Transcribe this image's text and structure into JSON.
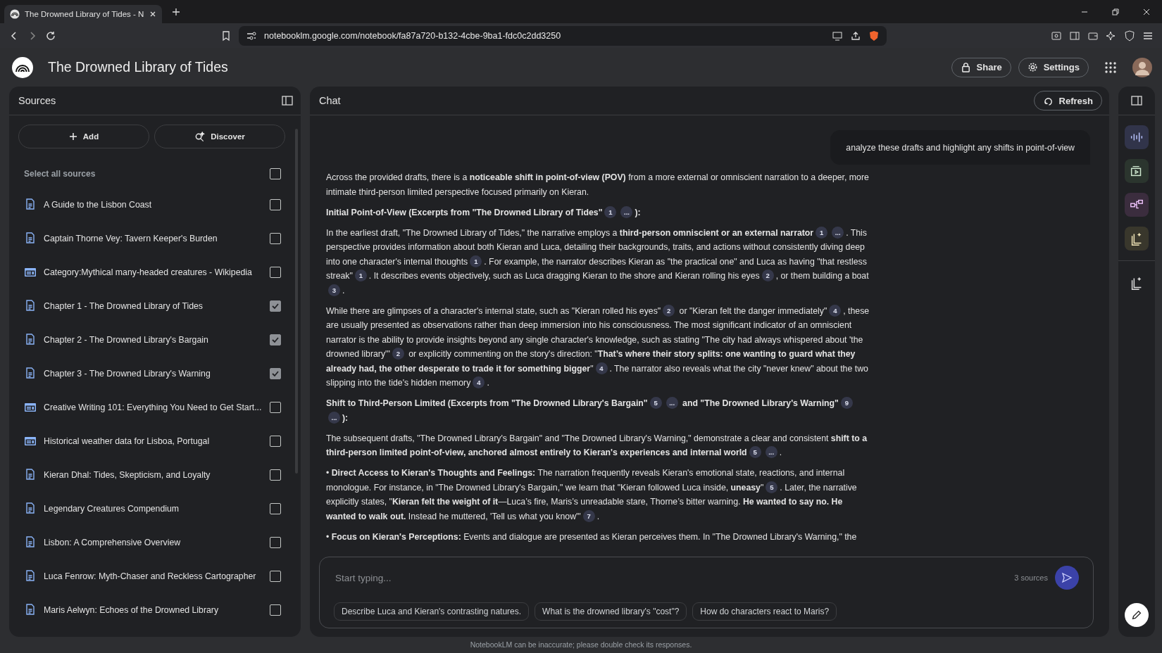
{
  "browser": {
    "tab_title": "The Drowned Library of Tides - N",
    "url": "notebooklm.google.com/notebook/fa87a720-b132-4cbe-9ba1-fdc0c2dd3250"
  },
  "header": {
    "title": "The Drowned Library of Tides",
    "share": "Share",
    "settings": "Settings"
  },
  "sources": {
    "title": "Sources",
    "add": "Add",
    "discover": "Discover",
    "select_all": {
      "label": "Select all sources",
      "checked": false
    },
    "items": [
      {
        "title": "A Guide to the Lisbon Coast",
        "kind": "doc",
        "checked": false
      },
      {
        "title": "Captain Thorne Vey: Tavern Keeper's Burden",
        "kind": "doc",
        "checked": false
      },
      {
        "title": "Category:Mythical many-headed creatures - Wikipedia",
        "kind": "web",
        "checked": false
      },
      {
        "title": "Chapter 1 - The Drowned Library of Tides",
        "kind": "doc",
        "checked": true
      },
      {
        "title": "Chapter 2 - The Drowned Library's Bargain",
        "kind": "doc",
        "checked": true
      },
      {
        "title": "Chapter 3 - The Drowned Library's Warning",
        "kind": "doc",
        "checked": true
      },
      {
        "title": "Creative Writing 101: Everything You Need to Get Start...",
        "kind": "web",
        "checked": false
      },
      {
        "title": "Historical weather data for Lisboa, Portugal",
        "kind": "web",
        "checked": false
      },
      {
        "title": "Kieran Dhal: Tides, Skepticism, and Loyalty",
        "kind": "doc",
        "checked": false
      },
      {
        "title": "Legendary Creatures Compendium",
        "kind": "doc",
        "checked": false
      },
      {
        "title": "Lisbon: A Comprehensive Overview",
        "kind": "doc",
        "checked": false
      },
      {
        "title": "Luca Fenrow: Myth-Chaser and Reckless Cartographer",
        "kind": "doc",
        "checked": false
      },
      {
        "title": "Maris Aelwyn: Echoes of the Drowned Library",
        "kind": "doc",
        "checked": false
      }
    ]
  },
  "chat": {
    "title": "Chat",
    "refresh": "Refresh",
    "user_message": "analyze these drafts and highlight any shifts in point-of-view",
    "paragraphs": [
      {
        "kind": "para",
        "parts": [
          {
            "kind": "text",
            "text": "Across the provided drafts, there is a **noticeable shift in point-of-view (POV)** from a more external or omniscient narration to a deeper, more intimate third-person limited perspective focused primarily on Kieran."
          }
        ]
      },
      {
        "kind": "heading",
        "parts": [
          {
            "kind": "text",
            "text": "Initial Point-of-View (Excerpts from \"The Drowned Library of Tides\""
          },
          {
            "kind": "cite",
            "label": "1"
          },
          {
            "kind": "cite",
            "label": "..."
          },
          {
            "kind": "text",
            "text": "):"
          }
        ]
      },
      {
        "kind": "para",
        "parts": [
          {
            "kind": "text",
            "text": "In the earliest draft, \"The Drowned Library of Tides,\" the narrative employs a **third-person omniscient or an external narrator**"
          },
          {
            "kind": "cite",
            "label": "1"
          },
          {
            "kind": "cite",
            "label": "..."
          },
          {
            "kind": "text",
            "text": ". This perspective provides information about both Kieran and Luca, detailing their backgrounds, traits, and actions without consistently diving deep into one character's internal thoughts"
          },
          {
            "kind": "cite",
            "label": "1"
          },
          {
            "kind": "text",
            "text": ". For example, the narrator describes Kieran as \"the practical one\" and Luca as having \"that restless streak\""
          },
          {
            "kind": "cite",
            "label": "1"
          },
          {
            "kind": "text",
            "text": ". It describes events objectively, such as Luca dragging Kieran to the shore and Kieran rolling his eyes"
          },
          {
            "kind": "cite",
            "label": "2"
          },
          {
            "kind": "text",
            "text": ", or them building a boat"
          },
          {
            "kind": "cite",
            "label": "3"
          },
          {
            "kind": "text",
            "text": "."
          }
        ]
      },
      {
        "kind": "para",
        "parts": [
          {
            "kind": "text",
            "text": "While there are glimpses of a character's internal state, such as \"Kieran rolled his eyes\""
          },
          {
            "kind": "cite",
            "label": "2"
          },
          {
            "kind": "text",
            "text": " or \"Kieran felt the danger immediately\""
          },
          {
            "kind": "cite",
            "label": "4"
          },
          {
            "kind": "text",
            "text": ", these are usually presented as observations rather than deep immersion into his consciousness. The most significant indicator of an omniscient narrator is the ability to provide insights beyond any single character's knowledge, such as stating \"The city had always whispered about 'the drowned library'\""
          },
          {
            "kind": "cite",
            "label": "2"
          },
          {
            "kind": "text",
            "text": " or explicitly commenting on the story's direction: \"**That’s where their story splits: one wanting to guard what they already had, the other desperate to trade it for something bigger**\""
          },
          {
            "kind": "cite",
            "label": "4"
          },
          {
            "kind": "text",
            "text": ". The narrator also reveals what the city \"never knew\" about the two slipping into the tide's hidden memory"
          },
          {
            "kind": "cite",
            "label": "4"
          },
          {
            "kind": "text",
            "text": "."
          }
        ]
      },
      {
        "kind": "heading",
        "parts": [
          {
            "kind": "text",
            "text": "Shift to Third-Person Limited (Excerpts from \"The Drowned Library's Bargain\""
          },
          {
            "kind": "cite",
            "label": "5"
          },
          {
            "kind": "cite",
            "label": "..."
          },
          {
            "kind": "text",
            "text": " and \"The Drowned Library's Warning\""
          },
          {
            "kind": "cite",
            "label": "9"
          },
          {
            "kind": "cite",
            "label": "..."
          },
          {
            "kind": "text",
            "text": "):"
          }
        ]
      },
      {
        "kind": "para",
        "parts": [
          {
            "kind": "text",
            "text": "The subsequent drafts, \"The Drowned Library's Bargain\" and \"The Drowned Library's Warning,\" demonstrate a clear and consistent **shift to a third-person limited point-of-view, anchored almost entirely to Kieran's experiences and internal world**"
          },
          {
            "kind": "cite",
            "label": "5"
          },
          {
            "kind": "cite",
            "label": "..."
          },
          {
            "kind": "text",
            "text": "."
          }
        ]
      },
      {
        "kind": "para",
        "parts": [
          {
            "kind": "text",
            "text": "• **Direct Access to Kieran's Thoughts and Feelings:** The narration frequently reveals Kieran's emotional state, reactions, and internal monologue. For instance, in \"The Drowned Library's Bargain,\" we learn that \"Kieran followed Luca inside, **uneasy**\""
          },
          {
            "kind": "cite",
            "label": "5"
          },
          {
            "kind": "text",
            "text": ". Later, the narrative explicitly states, \"**Kieran felt the weight of it**—Luca’s fire, Maris’s unreadable stare, Thorne’s bitter warning. **He wanted to say no. He wanted to walk out.** Instead he muttered, 'Tell us what you know'\""
          },
          {
            "kind": "cite",
            "label": "7"
          },
          {
            "kind": "text",
            "text": "."
          }
        ]
      },
      {
        "kind": "para",
        "parts": [
          {
            "kind": "text",
            "text": "• **Focus on Kieran's Perceptions:** Events and dialogue are presented as Kieran perceives them. In \"The Drowned Library's Warning,\" the"
          }
        ]
      }
    ],
    "input": {
      "placeholder": "Start typing...",
      "source_count": "3 sources"
    },
    "suggestions": [
      "Describe Luca and Kieran's contrasting natures.",
      "What is the drowned library's \"cost\"?",
      "How do characters react to Maris?"
    ]
  },
  "footer": "NotebookLM can be inaccurate; please double check its responses."
}
